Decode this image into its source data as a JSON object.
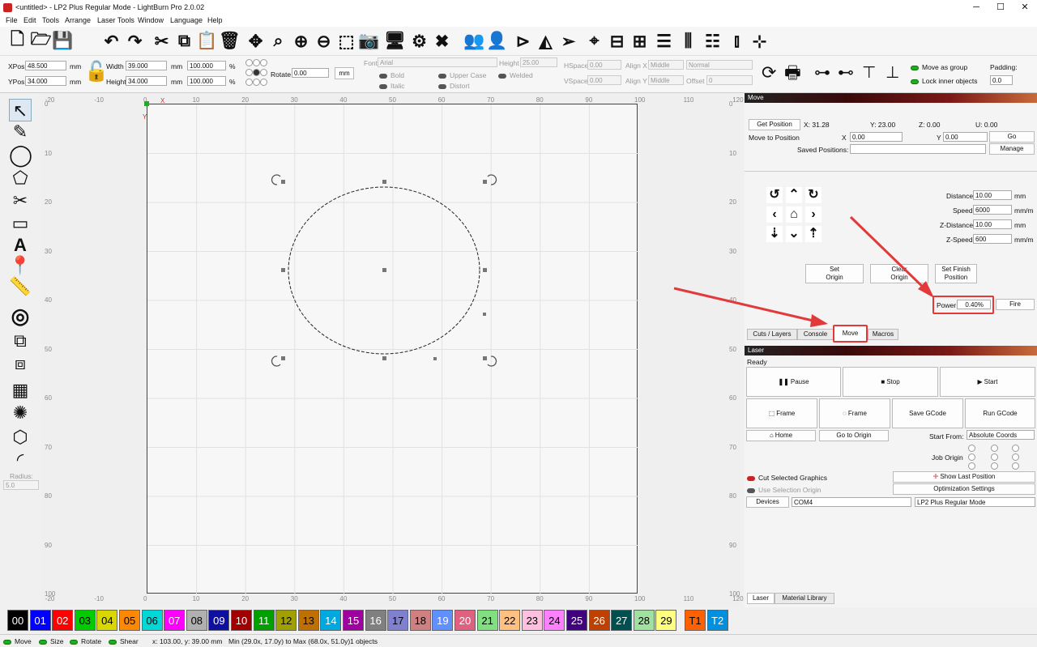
{
  "window": {
    "title": "<untitled> - LP2 Plus Regular Mode - LightBurn Pro 2.0.02",
    "minimize": "─",
    "maximize": "☐",
    "close": "✕"
  },
  "menu": [
    "File",
    "Edit",
    "Tools",
    "Arrange",
    "Laser Tools",
    "Window",
    "Language",
    "Help"
  ],
  "toolbar_icons": [
    "new-file-icon",
    "open-folder-icon",
    "save-icon",
    "undo-icon",
    "redo-icon",
    "cut-icon",
    "copy-icon",
    "paste-icon",
    "delete-icon",
    "move-icon",
    "zoom-selection-icon",
    "zoom-in-icon",
    "zoom-out-icon",
    "frame-selection-icon",
    "camera-icon",
    "monitor-icon",
    "settings-icon",
    "tools-icon",
    "users-icon",
    "user-icon",
    "mirror-h-icon",
    "mirror-v-icon",
    "send-icon",
    "target-icon",
    "align-icon",
    "distribute-icon",
    "group-icon",
    "dock-icon",
    "align-more-icon",
    "move-grid-icon"
  ],
  "props": {
    "xpos_label": "XPos",
    "xpos": "48.500",
    "ypos_label": "YPos",
    "ypos": "34.000",
    "unit": "mm",
    "width_label": "Width",
    "width": "39.000",
    "height_label": "Height",
    "height": "34.000",
    "wpct": "100.000",
    "hpct": "100.000",
    "pct": "%",
    "rotate_label": "Rotate",
    "rotate": "0.00",
    "mm_button": "mm",
    "font_label": "Font",
    "font": "Arial",
    "fheight_label": "Height",
    "fheight": "25.00",
    "hspace_label": "HSpace",
    "hspace": "0.00",
    "vspace_label": "VSpace",
    "vspace": "0.00",
    "alignx_label": "Align X",
    "alignx": "Middle",
    "aligny_label": "Align Y",
    "aligny": "Middle",
    "normal": "Normal",
    "offset_label": "Offset",
    "offset": "0",
    "bold": "Bold",
    "italic": "Italic",
    "upper": "Upper Case",
    "distort": "Distort",
    "welded": "Welded",
    "move_group": "Move as group",
    "lock_inner": "Lock inner objects",
    "padding_label": "Padding:",
    "padding": "0.0"
  },
  "left_tools": {
    "radius_label": "Radius:",
    "radius": "5.0"
  },
  "canvas": {
    "xticks": [
      "-20",
      "-10",
      "0",
      "10",
      "20",
      "30",
      "40",
      "50",
      "60",
      "70",
      "80",
      "90",
      "100",
      "110",
      "120"
    ],
    "yticks": [
      "0",
      "10",
      "20",
      "30",
      "40",
      "50",
      "60",
      "70",
      "80",
      "90",
      "100"
    ],
    "x_axis": "X",
    "y_axis": "Y"
  },
  "move": {
    "title": "Move",
    "get_position": "Get Position",
    "x": "X: 31.28",
    "y": "Y: 23.00",
    "z": "Z: 0.00",
    "u": "U: 0.00",
    "move_to": "Move to Position",
    "x_label": "X",
    "x_val": "0.00",
    "y_label": "Y",
    "y_val": "0.00",
    "go": "Go",
    "saved_label": "Saved Positions:",
    "manage": "Manage",
    "distance_label": "Distance",
    "distance": "10.00",
    "speed_label": "Speed",
    "speed": "6000",
    "zdist_label": "Z-Distance",
    "zdist": "10.00",
    "zspeed_label": "Z-Speed",
    "zspeed": "600",
    "mm": "mm",
    "mmmin": "mm/m",
    "set_origin": "Set\nOrigin",
    "clear_origin": "Clear\nOrigin",
    "set_finish": "Set Finish\nPosition",
    "power_label": "Power",
    "power": "0.40%",
    "fire": "Fire"
  },
  "tabs_top": [
    "Cuts / Layers",
    "Console",
    "Move",
    "Macros"
  ],
  "laser": {
    "title": "Laser",
    "status": "Ready",
    "pause": "Pause",
    "stop": "Stop",
    "start": "Start",
    "frame1": "Frame",
    "frame2": "Frame",
    "save_gcode": "Save GCode",
    "run_gcode": "Run GCode",
    "home": "Home",
    "go_origin": "Go to Origin",
    "start_from_label": "Start From:",
    "start_from": "Absolute Coords",
    "job_origin": "Job Origin",
    "cut_selected": "Cut Selected Graphics",
    "use_origin": "Use Selection Origin",
    "show_last": "Show Last Position",
    "optimization": "Optimization Settings",
    "devices": "Devices",
    "port": "COM4",
    "device": "LP2 Plus Regular Mode"
  },
  "tabs_bottom": [
    "Laser",
    "Material Library"
  ],
  "palette": [
    {
      "l": "00",
      "c": "#000000",
      "t": "#ffffff"
    },
    {
      "l": "01",
      "c": "#0000ff",
      "t": "#ffffff"
    },
    {
      "l": "02",
      "c": "#ff0000",
      "t": "#ffffff"
    },
    {
      "l": "03",
      "c": "#00cc00",
      "t": "#000000"
    },
    {
      "l": "04",
      "c": "#d8d800",
      "t": "#000000"
    },
    {
      "l": "05",
      "c": "#ff8800",
      "t": "#000000"
    },
    {
      "l": "06",
      "c": "#00d8d8",
      "t": "#000000"
    },
    {
      "l": "07",
      "c": "#ff00ff",
      "t": "#ffffff"
    },
    {
      "l": "08",
      "c": "#b0b0b0",
      "t": "#000000"
    },
    {
      "l": "09",
      "c": "#1010a0",
      "t": "#ffffff"
    },
    {
      "l": "10",
      "c": "#a00000",
      "t": "#ffffff"
    },
    {
      "l": "11",
      "c": "#00a000",
      "t": "#ffffff"
    },
    {
      "l": "12",
      "c": "#a0a000",
      "t": "#000000"
    },
    {
      "l": "13",
      "c": "#c07000",
      "t": "#000000"
    },
    {
      "l": "14",
      "c": "#00a8e0",
      "t": "#ffffff"
    },
    {
      "l": "15",
      "c": "#a000a0",
      "t": "#ffffff"
    },
    {
      "l": "16",
      "c": "#808080",
      "t": "#ffffff"
    },
    {
      "l": "17",
      "c": "#8080d0",
      "t": "#000000"
    },
    {
      "l": "18",
      "c": "#d08080",
      "t": "#000000"
    },
    {
      "l": "19",
      "c": "#6090ff",
      "t": "#ffffff"
    },
    {
      "l": "20",
      "c": "#e06080",
      "t": "#ffffff"
    },
    {
      "l": "21",
      "c": "#80e080",
      "t": "#000000"
    },
    {
      "l": "22",
      "c": "#ffc080",
      "t": "#000000"
    },
    {
      "l": "23",
      "c": "#ffc0e0",
      "t": "#000000"
    },
    {
      "l": "24",
      "c": "#ff80ff",
      "t": "#000000"
    },
    {
      "l": "25",
      "c": "#400080",
      "t": "#ffffff"
    },
    {
      "l": "26",
      "c": "#c04000",
      "t": "#ffffff"
    },
    {
      "l": "27",
      "c": "#005050",
      "t": "#ffffff"
    },
    {
      "l": "28",
      "c": "#a0e0a0",
      "t": "#000000"
    },
    {
      "l": "29",
      "c": "#ffff80",
      "t": "#000000"
    },
    {
      "l": "T1",
      "c": "#ff6000",
      "t": "#000000"
    },
    {
      "l": "T2",
      "c": "#0090e0",
      "t": "#ffffff"
    }
  ],
  "status": {
    "move": "Move",
    "size": "Size",
    "rotate": "Rotate",
    "shear": "Shear",
    "coords": "x: 103.00, y: 39.00 mm",
    "minmax": "Min (29.0x, 17.0y) to Max (68.0x, 51.0y)",
    "objects": "1 objects"
  }
}
